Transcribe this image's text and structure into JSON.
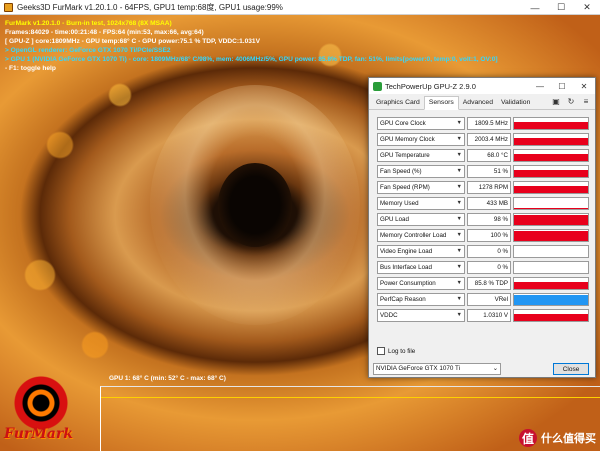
{
  "furmark": {
    "title": "Geeks3D FurMark v1.20.1.0 - 64FPS, GPU1 temp:68度, GPU1 usage:99%",
    "controls": {
      "minimize": "—",
      "maximize": "☐",
      "close": "✕"
    },
    "overlay": [
      {
        "text": "FurMark v1.20.1.0 - Burn-in test, 1024x768 (8X MSAA)",
        "color": "y"
      },
      {
        "text": "Frames:84029 - time:00:21:48 - FPS:64 (min:53, max:66, avg:64)",
        "color": "w"
      },
      {
        "text": "[ GPU-Z ] core:1809MHz - GPU temp:68° C - GPU power:75.1 % TDP, VDDC:1.031V",
        "color": "w"
      },
      {
        "text": "> OpenGL renderer: GeForce GTX 1070 Ti/PCIe/SSE2",
        "color": "c"
      },
      {
        "text": "> GPU 1 (NVIDIA GeForce GTX 1070 Ti) - core: 1809MHz/68° C/98%, mem: 4006MHz/5%, GPU power: 85.8% TDP, fan: 51%, limits[power:0, temp:0, volt:1, OV:0]",
        "color": "c"
      },
      {
        "text": "- F1: toggle help",
        "color": "w"
      }
    ],
    "temp_graph_label": "GPU 1: 68° C (min: 52° C - max: 68° C)",
    "logo_text": "FurMark"
  },
  "gpuz": {
    "title": "TechPowerUp GPU-Z 2.9.0",
    "controls": {
      "minimize": "—",
      "maximize": "☐",
      "close": "✕"
    },
    "tabs": [
      {
        "label": "Graphics Card",
        "active": false
      },
      {
        "label": "Sensors",
        "active": true
      },
      {
        "label": "Advanced",
        "active": false
      },
      {
        "label": "Validation",
        "active": false
      }
    ],
    "sensors": [
      {
        "name": "GPU Core Clock",
        "value": "1809.5 MHz",
        "fill": 0.55,
        "color": "#e8001c"
      },
      {
        "name": "GPU Memory Clock",
        "value": "2003.4 MHz",
        "fill": 0.55,
        "color": "#e8001c"
      },
      {
        "name": "GPU Temperature",
        "value": "68.0 °C",
        "fill": 0.55,
        "color": "#e8001c"
      },
      {
        "name": "Fan Speed (%)",
        "value": "51 %",
        "fill": 0.55,
        "color": "#e8001c"
      },
      {
        "name": "Fan Speed (RPM)",
        "value": "1278 RPM",
        "fill": 0.55,
        "color": "#e8001c"
      },
      {
        "name": "Memory Used",
        "value": "433 MB",
        "fill": 0.08,
        "color": "#e8001c"
      },
      {
        "name": "GPU Load",
        "value": "98 %",
        "fill": 0.85,
        "color": "#e8001c"
      },
      {
        "name": "Memory Controller Load",
        "value": "100 %",
        "fill": 0.85,
        "color": "#e8001c"
      },
      {
        "name": "Video Engine Load",
        "value": "0 %",
        "fill": 0.0,
        "color": "#e8001c"
      },
      {
        "name": "Bus Interface Load",
        "value": "0 %",
        "fill": 0.0,
        "color": "#e8001c"
      },
      {
        "name": "Power Consumption",
        "value": "85.8 % TDP",
        "fill": 0.6,
        "color": "#e8001c"
      },
      {
        "name": "PerfCap Reason",
        "value": "VRel",
        "fill": 0.85,
        "color": "#2196f3"
      },
      {
        "name": "VDDC",
        "value": "1.0310 V",
        "fill": 0.55,
        "color": "#e8001c"
      }
    ],
    "log_to_file": "Log to file",
    "gpu_select": "NVIDIA GeForce GTX 1070 Ti",
    "close_button": "Close"
  },
  "watermark": {
    "icon": "值",
    "text": "什么值得买"
  }
}
